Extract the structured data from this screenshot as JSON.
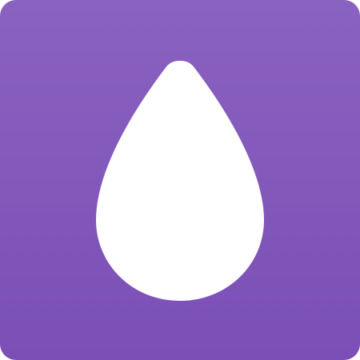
{
  "icon": {
    "name": "water-drop-icon",
    "background_top": "#8A62C0",
    "background_bottom": "#7B4FB6",
    "glyph_color": "#FFFFFF"
  }
}
